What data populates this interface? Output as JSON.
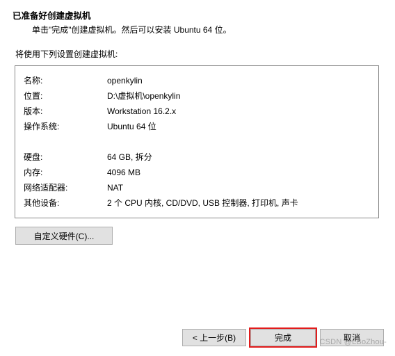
{
  "header": {
    "title": "已准备好创建虚拟机",
    "subtitle": "单击\"完成\"创建虚拟机。然后可以安装 Ubuntu 64 位。"
  },
  "intro": "将使用下列设置创建虚拟机:",
  "summary": {
    "name_label": "名称:",
    "name_value": "openkylin",
    "location_label": "位置:",
    "location_value": "D:\\虚拟机\\openkylin",
    "version_label": "版本:",
    "version_value": "Workstation 16.2.x",
    "os_label": "操作系统:",
    "os_value": "Ubuntu 64 位",
    "disk_label": "硬盘:",
    "disk_value": "64 GB, 拆分",
    "memory_label": "内存:",
    "memory_value": "4096 MB",
    "net_label": "网络适配器:",
    "net_value": "NAT",
    "other_label": "其他设备:",
    "other_value": "2 个 CPU 内核, CD/DVD, USB 控制器, 打印机, 声卡"
  },
  "buttons": {
    "customize": "自定义硬件(C)...",
    "back": "< 上一步(B)",
    "finish": "完成",
    "cancel": "取消"
  },
  "watermark": "CSDN @LBoZhou-"
}
